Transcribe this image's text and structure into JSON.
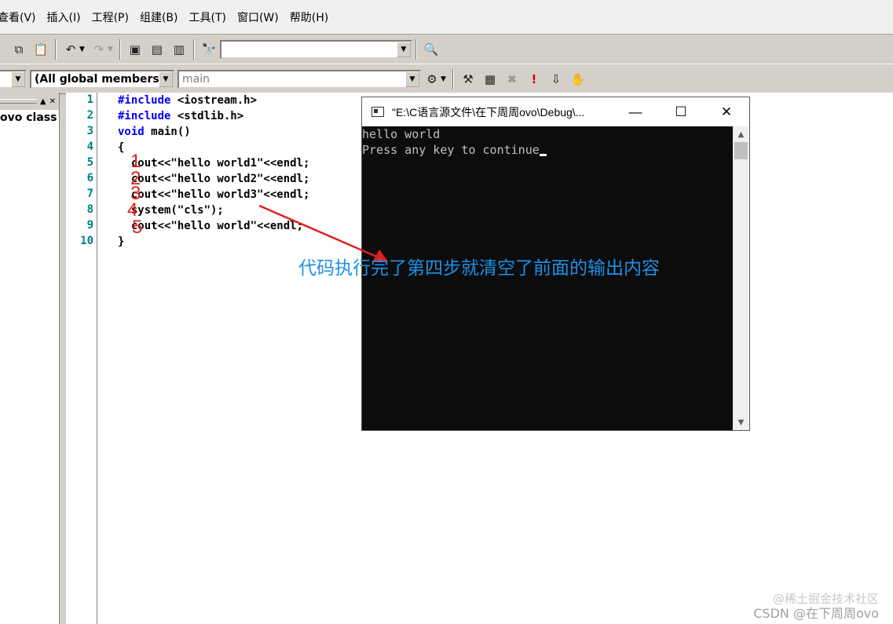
{
  "menubar": {
    "items": [
      "查看(V)",
      "插入(I)",
      "工程(P)",
      "组建(B)",
      "工具(T)",
      "窗口(W)",
      "帮助(H)"
    ]
  },
  "toolbar2": {
    "class_combo": "(All global members",
    "func_combo": "main"
  },
  "workspace": {
    "class_label": "ovo class"
  },
  "editor": {
    "line_numbers": [
      "1",
      "2",
      "3",
      "4",
      "5",
      "6",
      "7",
      "8",
      "9",
      "10"
    ],
    "code": {
      "l1_kw": "#include",
      "l1_rest": " <iostream.h>",
      "l2_kw": "#include",
      "l2_rest": " <stdlib.h>",
      "l3_kw": "void",
      "l3_rest": " main()",
      "l4": "{",
      "l5": "  cout<<\"hello world1\"<<endl;",
      "l6": "  cout<<\"hello world2\"<<endl;",
      "l7": "  cout<<\"hello world3\"<<endl;",
      "l8": "  system(\"cls\");",
      "l9": "  cout<<\"hello world\"<<endl;",
      "l10": "}"
    },
    "step_marks": [
      "1",
      "2",
      "3",
      "4",
      "5"
    ]
  },
  "console": {
    "title": "\"E:\\C语言源文件\\在下周周ovo\\Debug\\...",
    "line1": "hello world",
    "line2": "Press any key to continue"
  },
  "annotation": "代码执行完了第四步就清空了前面的输出内容",
  "watermark": {
    "line1": "@稀土掘金技术社区",
    "line2": "CSDN @在下周周ovo"
  },
  "colors": {
    "keyword": "#0000ff",
    "line_number": "#008080",
    "step_mark": "#e02020",
    "annotation": "#1e90e8"
  }
}
